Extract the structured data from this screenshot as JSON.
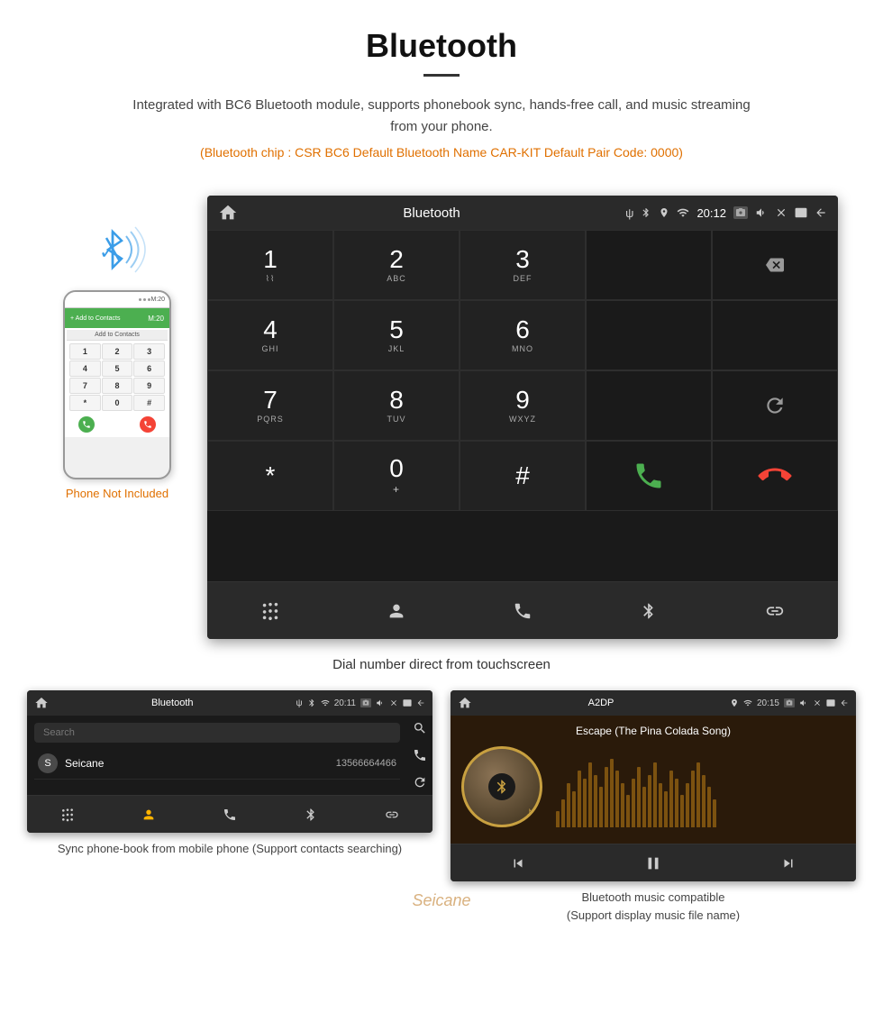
{
  "header": {
    "title": "Bluetooth",
    "description": "Integrated with BC6 Bluetooth module, supports phonebook sync, hands-free call, and music streaming from your phone.",
    "specs": "(Bluetooth chip : CSR BC6   Default Bluetooth Name CAR-KIT   Default Pair Code: 0000)"
  },
  "phone_mockup": {
    "top_status": "M:20",
    "green_bar_text": "+ Add to Contacts",
    "contact_bar": "Add to Contacts",
    "dialpad_keys": [
      "1",
      "2",
      "3",
      "4",
      "5",
      "6",
      "7",
      "8",
      "9",
      "*",
      "0",
      "#"
    ]
  },
  "phone_not_included": "Phone Not Included",
  "main_car_screen": {
    "title": "Bluetooth",
    "time": "20:12",
    "usb_label": "ψ",
    "dialpad": [
      {
        "num": "1",
        "sub": "⌇⌇"
      },
      {
        "num": "2",
        "sub": "ABC"
      },
      {
        "num": "3",
        "sub": "DEF"
      },
      {
        "num": "",
        "sub": ""
      },
      {
        "num": "",
        "sub": "backspace"
      },
      {
        "num": "4",
        "sub": "GHI"
      },
      {
        "num": "5",
        "sub": "JKL"
      },
      {
        "num": "6",
        "sub": "MNO"
      },
      {
        "num": "",
        "sub": ""
      },
      {
        "num": "",
        "sub": ""
      },
      {
        "num": "7",
        "sub": "PQRS"
      },
      {
        "num": "8",
        "sub": "TUV"
      },
      {
        "num": "9",
        "sub": "WXYZ"
      },
      {
        "num": "",
        "sub": ""
      },
      {
        "num": "",
        "sub": "refresh"
      },
      {
        "num": "*",
        "sub": ""
      },
      {
        "num": "0",
        "sub": "+"
      },
      {
        "num": "#",
        "sub": ""
      },
      {
        "num": "",
        "sub": "call_green"
      },
      {
        "num": "",
        "sub": "call_red"
      }
    ]
  },
  "main_caption": "Dial number direct from touchscreen",
  "phonebook_screen": {
    "top_title": "Bluetooth",
    "time": "20:11",
    "search_placeholder": "Search",
    "contacts": [
      {
        "letter": "S",
        "name": "Seicane",
        "number": "13566664466"
      }
    ],
    "bottom_caption": "Sync phone-book from mobile phone\n(Support contacts searching)"
  },
  "music_screen": {
    "top_title": "A2DP",
    "time": "20:15",
    "song_title": "Escape (The Pina Colada Song)",
    "bottom_caption": "Bluetooth music compatible\n(Support display music file name)"
  },
  "watermark": "Seicane",
  "colors": {
    "accent_orange": "#e07000",
    "android_bg": "#1a1a1a",
    "android_bar": "#2a2a2a",
    "call_green": "#4caf50",
    "call_red": "#f44336",
    "bluetooth_blue": "#3b9de8",
    "gold": "#c8a040"
  }
}
